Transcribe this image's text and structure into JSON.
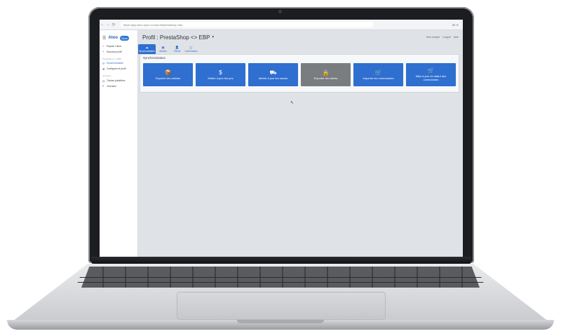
{
  "browser": {
    "url": "https://app.atoo-sync.com/profil/prestashop-ebp",
    "nav_back": "←",
    "nav_forward": "→",
    "nav_reload": "⟳",
    "zoom": "80 %"
  },
  "sidebar": {
    "brand_main": "Atoo",
    "brand_pill": "Sync",
    "items_top": [
      {
        "label": "Espace Client",
        "icon": "home-icon"
      },
      {
        "label": "Nouveau profil",
        "icon": "add-icon"
      }
    ],
    "group_label": "PrestaShop <> EBP",
    "items_profile": [
      {
        "label": "Synchronisation",
        "icon": "sync-icon",
        "active": true
      },
      {
        "label": "Configurer le profil",
        "icon": "wrench-icon",
        "active": false
      }
    ],
    "group2_label": "Journaux",
    "items_bottom": [
      {
        "label": "Tâches planifiées",
        "icon": "clock-icon"
      },
      {
        "label": "Journaux",
        "icon": "log-icon"
      }
    ]
  },
  "header": {
    "title": "Profil : PrestaShop <> EBP",
    "caret": "▾",
    "right_links": [
      "Mon compte",
      "Langue",
      "Aide"
    ]
  },
  "tabs": [
    {
      "label": "Synchronisation",
      "icon": "☁",
      "active": true
    },
    {
      "label": "Articles",
      "icon": "▣",
      "active": false
    },
    {
      "label": "Clients",
      "icon": "👤",
      "active": false
    },
    {
      "label": "Commandes",
      "icon": "🛒",
      "active": false
    }
  ],
  "panel": {
    "title": "Synchronisation",
    "actions": [
      {
        "label": "Exporter les articles",
        "icon": "📦",
        "disabled": false
      },
      {
        "label": "Mettre à jour les prix",
        "icon": "$",
        "disabled": false
      },
      {
        "label": "Mettre à jour les stocks",
        "icon": "⛟",
        "disabled": false
      },
      {
        "label": "Exporter les clients",
        "icon": "🔒",
        "disabled": true
      },
      {
        "label": "Importer les commandes",
        "icon": "🛒",
        "disabled": false
      },
      {
        "label": "Mise à jour du statut des commandes",
        "icon": "🛒",
        "disabled": false
      }
    ]
  },
  "colors": {
    "accent": "#2f6fd0",
    "disabled": "#7a7d80",
    "background": "#dfe2e6"
  }
}
